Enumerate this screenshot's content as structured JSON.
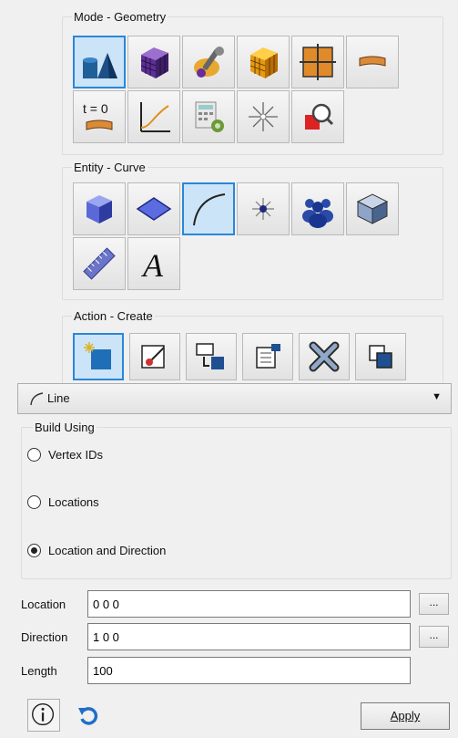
{
  "mode_group": {
    "title": "Mode - Geometry"
  },
  "entity_group": {
    "title": "Entity - Curve"
  },
  "action_group": {
    "title": "Action - Create"
  },
  "mode_text": {
    "t_eq_0": "t = 0"
  },
  "entity_text": {
    "letter_a": "A"
  },
  "curve_type": {
    "selected": "Line",
    "icon": "curve-arc-icon"
  },
  "build_using": {
    "title": "Build Using",
    "options": [
      "Vertex IDs",
      "Locations",
      "Location and Direction"
    ],
    "selected_index": 2
  },
  "fields": {
    "location": {
      "label": "Location",
      "value": "0 0 0",
      "browse": "..."
    },
    "direction": {
      "label": "Direction",
      "value": "1 0 0",
      "browse": "..."
    },
    "length": {
      "label": "Length",
      "value": "100"
    }
  },
  "buttons": {
    "apply": "Apply",
    "info_icon": "info-icon",
    "reset_icon": "reset-icon"
  },
  "colors": {
    "accent": "#2b86d8",
    "selected_bg": "#cce4f7"
  }
}
